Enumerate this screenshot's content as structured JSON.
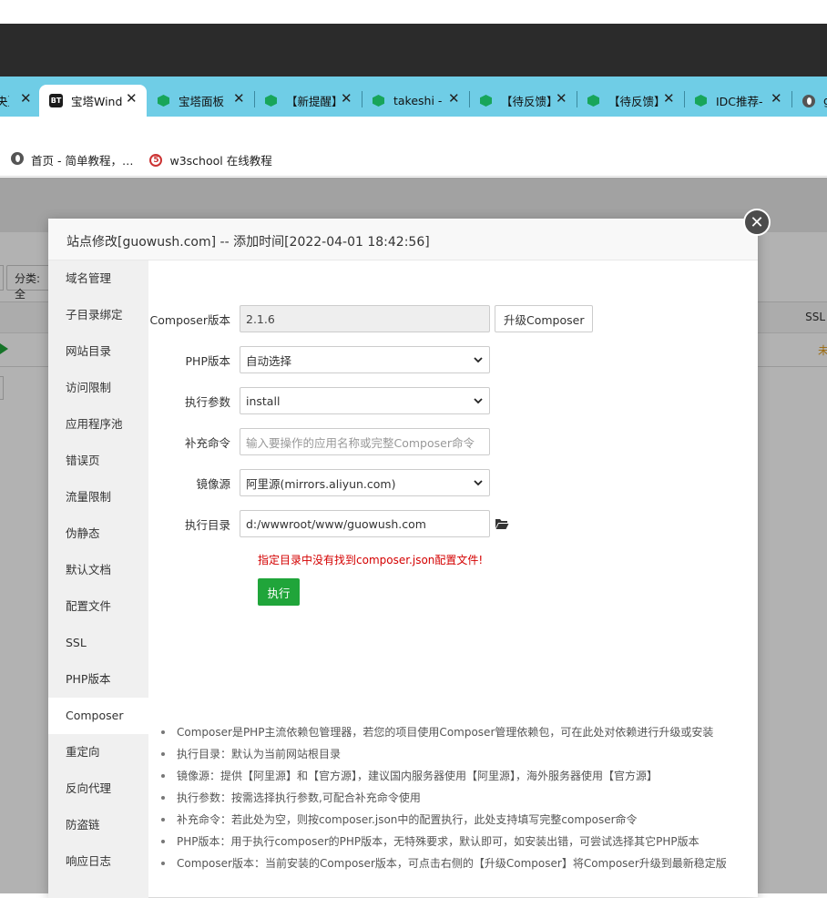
{
  "browser": {
    "tabs": [
      {
        "label": "夬】",
        "icon": "none"
      },
      {
        "label": "宝塔Wind",
        "icon": "bt-icon"
      },
      {
        "label": "宝塔面板 ·",
        "icon": "hex-icon"
      },
      {
        "label": "【新提醒】",
        "icon": "hex-icon"
      },
      {
        "label": "takeshi -",
        "icon": "hex-icon"
      },
      {
        "label": "【待反馈】",
        "icon": "hex-icon"
      },
      {
        "label": "【待反馈】",
        "icon": "hex-icon"
      },
      {
        "label": "IDC推荐-",
        "icon": "hex-icon"
      },
      {
        "label": "g",
        "icon": "globe-icon"
      }
    ],
    "bookmarks": [
      {
        "label": "首页 - 简单教程，…",
        "icon": "globe-icon"
      },
      {
        "label": "w3school 在线教程",
        "icon": "w3school-icon"
      }
    ]
  },
  "background": {
    "filter_label": "分类: 全",
    "ssl_header": "SSL",
    "status_text": "未"
  },
  "dialog": {
    "title": "站点修改[guowush.com] -- 添加时间[2022-04-01 18:42:56]",
    "sidebar": [
      "域名管理",
      "子目录绑定",
      "网站目录",
      "访问限制",
      "应用程序池",
      "错误页",
      "流量限制",
      "伪静态",
      "默认文档",
      "配置文件",
      "SSL",
      "PHP版本",
      "Composer",
      "重定向",
      "反向代理",
      "防盗链",
      "响应日志"
    ],
    "active_item": "Composer",
    "form": {
      "composer_version_label": "Composer版本",
      "composer_version_value": "2.1.6",
      "upgrade_button": "升级Composer",
      "php_version_label": "PHP版本",
      "php_version_value": "自动选择",
      "exec_args_label": "执行参数",
      "exec_args_value": "install",
      "extra_cmd_label": "补充命令",
      "extra_cmd_placeholder": "输入要操作的应用名称或完整Composer命令",
      "mirror_label": "镜像源",
      "mirror_value": "阿里源(mirrors.aliyun.com)",
      "exec_dir_label": "执行目录",
      "exec_dir_value": "d:/wwwroot/www/guowush.com",
      "error_message": "指定目录中没有找到composer.json配置文件!",
      "execute_button": "执行"
    },
    "tips": [
      "Composer是PHP主流依赖包管理器，若您的项目使用Composer管理依赖包，可在此处对依赖进行升级或安装",
      "执行目录：默认为当前网站根目录",
      "镜像源：提供【阿里源】和【官方源】，建议国内服务器使用【阿里源】，海外服务器使用【官方源】",
      "执行参数：按需选择执行参数,可配合补充命令使用",
      "补充命令：若此处为空，则按composer.json中的配置执行，此处支持填写完整composer命令",
      "PHP版本：用于执行composer的PHP版本，无特殊要求，默认即可，如安装出错，可尝试选择其它PHP版本",
      "Composer版本：当前安装的Composer版本，可点击右侧的【升级Composer】将Composer升级到最新稳定版"
    ]
  },
  "colors": {
    "tabstrip": "#6fcde6",
    "accent_green": "#20a53a",
    "error_red": "#d40000"
  }
}
